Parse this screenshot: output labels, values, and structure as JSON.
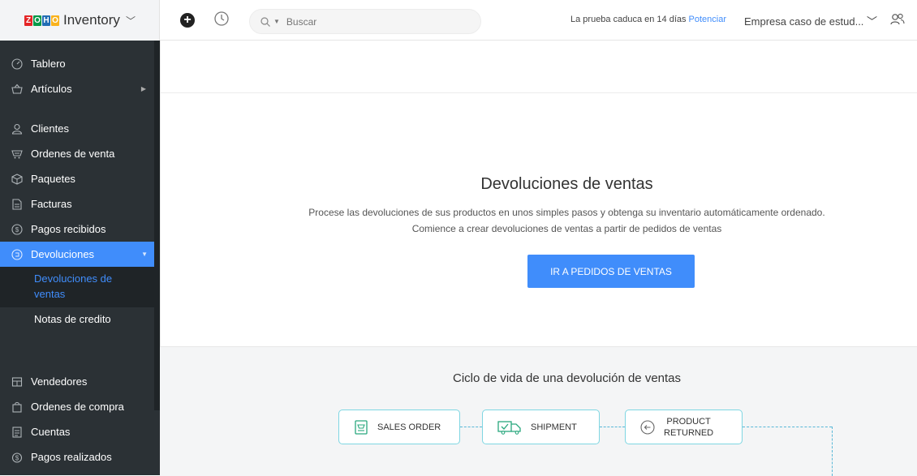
{
  "app": {
    "name": "Inventory",
    "logo_letters": [
      "Z",
      "O",
      "H",
      "O"
    ],
    "logo_colors": [
      "#e42527",
      "#089949",
      "#226db4",
      "#f9b21d"
    ]
  },
  "topbar": {
    "search_placeholder": "Buscar",
    "trial_text": "La prueba caduca en 14 días",
    "upgrade_label": "Potenciar",
    "company_label": "Empresa caso de estud... ﹀"
  },
  "sidebar": {
    "items": [
      {
        "label": "Tablero",
        "icon": "dashboard-icon"
      },
      {
        "label": "Artículos",
        "icon": "basket-icon"
      },
      {
        "label": "Clientes",
        "icon": "user-icon"
      },
      {
        "label": "Ordenes de venta",
        "icon": "cart-icon"
      },
      {
        "label": "Paquetes",
        "icon": "package-icon"
      },
      {
        "label": "Facturas",
        "icon": "invoice-icon"
      },
      {
        "label": "Pagos recibidos",
        "icon": "payment-icon"
      },
      {
        "label": "Devoluciones",
        "icon": "returns-icon"
      },
      {
        "label": "Vendedores",
        "icon": "vendor-icon"
      },
      {
        "label": "Ordenes de compra",
        "icon": "purchase-bag-icon"
      },
      {
        "label": "Cuentas",
        "icon": "bill-icon"
      },
      {
        "label": "Pagos realizados",
        "icon": "payments-made-icon"
      }
    ],
    "submenu": [
      {
        "label": "Devoluciones de ventas"
      },
      {
        "label": "Notas de credito"
      }
    ],
    "active_color": "#408dfb"
  },
  "main": {
    "title": "Devoluciones de ventas",
    "desc_line1": "Procese las devoluciones de sus productos en unos simples pasos y obtenga su inventario automáticamente ordenado.",
    "desc_line2": "Comience a crear devoluciones de ventas a partir de pedidos de ventas",
    "cta_label": "IR A PEDIDOS DE VENTAS"
  },
  "lifecycle": {
    "title": "Ciclo de vida de una devolución de ventas",
    "stages": [
      {
        "label": "SALES ORDER",
        "icon": "sales-order-icon"
      },
      {
        "label": "SHIPMENT",
        "icon": "shipment-truck-icon"
      },
      {
        "label_line1": "PRODUCT",
        "label_line2": "RETURNED",
        "icon": "product-returned-icon"
      }
    ]
  }
}
